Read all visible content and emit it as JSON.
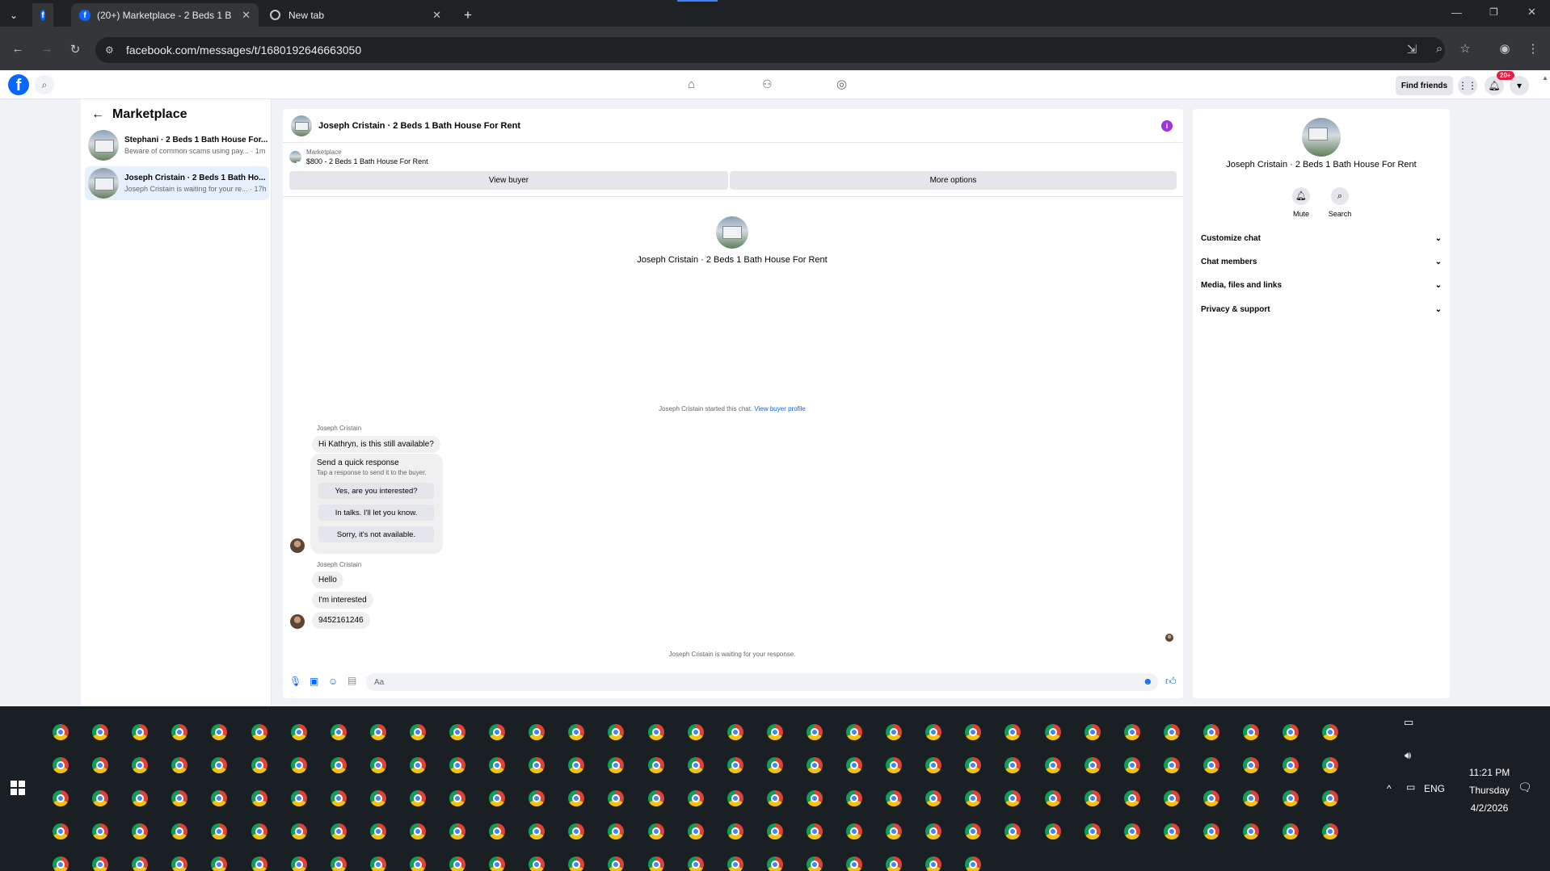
{
  "browser": {
    "tabs": [
      {
        "title": "(20+) Marketplace - 2 Beds 1 B",
        "active": true
      },
      {
        "title": "New tab",
        "active": false
      }
    ],
    "url": "facebook.com/messages/t/1680192646663050",
    "new_tab_label": "+"
  },
  "fb_header": {
    "logo": "f",
    "find_friends": "Find friends",
    "notif_badge": "20+"
  },
  "left_panel": {
    "title": "Marketplace",
    "conversations": [
      {
        "name": "Stephani · 2 Beds 1 Bath House For...",
        "preview": "Beware of common scams using pay... · 1m",
        "selected": false
      },
      {
        "name": "Joseph Cristain · 2 Beds 1 Bath Ho...",
        "preview": "Joseph Cristain is waiting for your re... · 17h",
        "selected": true
      }
    ]
  },
  "chat": {
    "header_title": "Joseph Cristain · 2 Beds 1 Bath House For Rent",
    "listing_category": "Marketplace",
    "listing_title": "$800 - 2 Beds 1 Bath House For Rent",
    "view_buyer": "View buyer",
    "more_options": "More options",
    "center_name": "Joseph Cristain · 2 Beds 1 Bath House For Rent",
    "started_text": "Joseph Cristain started this chat.",
    "view_buyer_profile": "View buyer profile",
    "sender_name": "Joseph Cristain",
    "msg1": "Hi Kathryn, is this still available?",
    "quick_title": "Send a quick response",
    "quick_sub": "Tap a response to send it to the buyer.",
    "quick_responses": [
      "Yes, are you interested?",
      "In talks. I'll let you know.",
      "Sorry, it's not available."
    ],
    "msg2": "Hello",
    "msg3": "I'm interested",
    "msg4": "9452161246",
    "waiting": "Joseph Cristain is waiting for your response.",
    "composer_placeholder": "Aa"
  },
  "right_panel": {
    "name": "Joseph Cristain · 2 Beds 1 Bath House For Rent",
    "mute": "Mute",
    "search": "Search",
    "sections": [
      "Customize chat",
      "Chat members",
      "Media, files and links",
      "Privacy & support"
    ]
  },
  "taskbar": {
    "lang": "ENG",
    "time": "11:21 PM",
    "day": "Thursday",
    "date": "4/2/2026"
  },
  "colors": {
    "fb_blue": "#0866ff",
    "info_purple": "#a033e5",
    "badge_red": "#e41e3f",
    "taskbar": "#1a1f23"
  }
}
